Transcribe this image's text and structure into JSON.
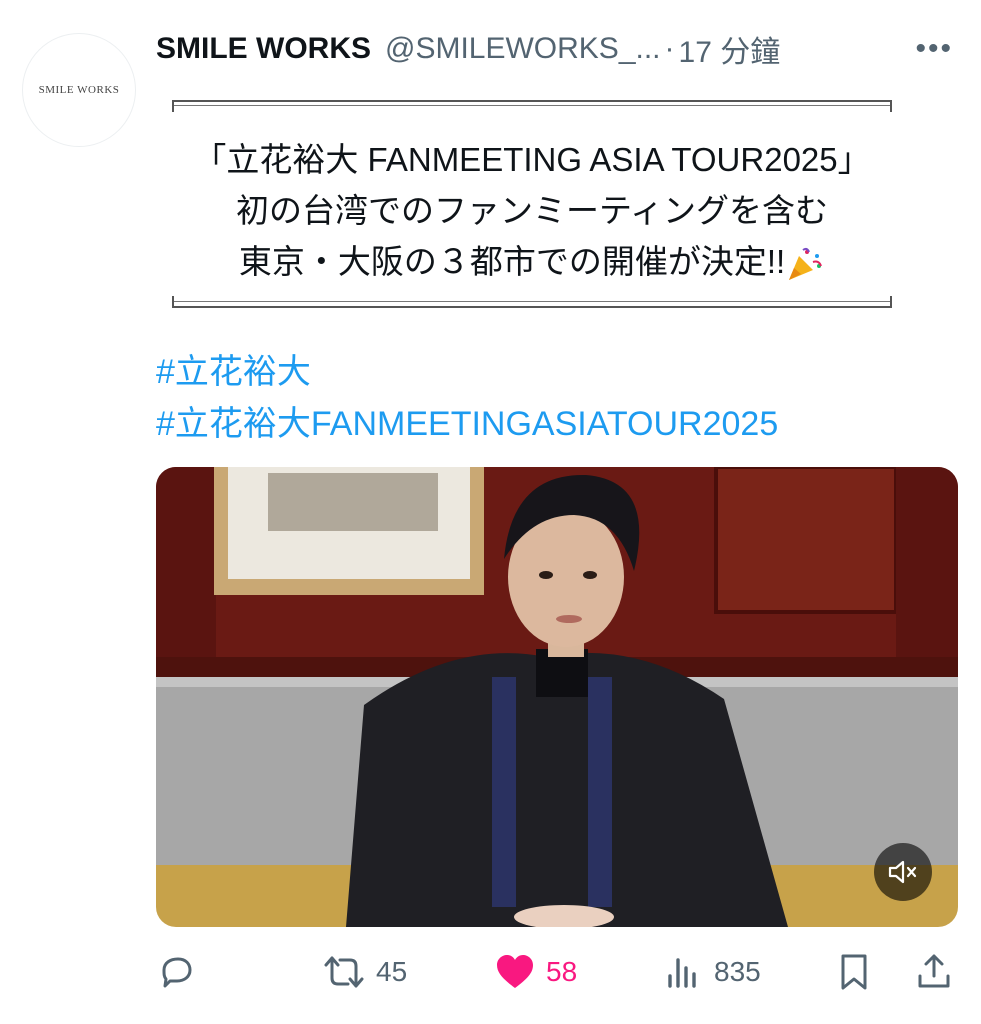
{
  "post": {
    "avatar_text": "SMILE WORKS",
    "display_name": "SMILE WORKS",
    "handle": "@SMILEWORKS_...",
    "separator": "·",
    "time": "17 分鐘",
    "more_label": "•••",
    "announcement": {
      "line1": "「立花裕大 FANMEETING ASIA TOUR2025」",
      "line2": "初の台湾でのファンミーティングを含む",
      "line3": "東京・大阪の３都市での開催が決定!!"
    },
    "hashtags": [
      "#立花裕大",
      "#立花裕大FANMEETINGASIATOUR2025"
    ],
    "media": {
      "muted_icon": "speaker-muted-icon"
    },
    "actions": {
      "reply": {
        "icon": "reply-icon",
        "count": ""
      },
      "repost": {
        "icon": "repost-icon",
        "count": "45"
      },
      "like": {
        "icon": "heart-icon",
        "count": "58",
        "liked": true
      },
      "views": {
        "icon": "views-chart-icon",
        "count": "835"
      },
      "bookmark": {
        "icon": "bookmark-icon"
      },
      "share": {
        "icon": "share-icon"
      }
    }
  },
  "colors": {
    "text": "#0f1419",
    "secondary": "#536471",
    "link": "#1d9bf0",
    "like": "#f91880"
  }
}
